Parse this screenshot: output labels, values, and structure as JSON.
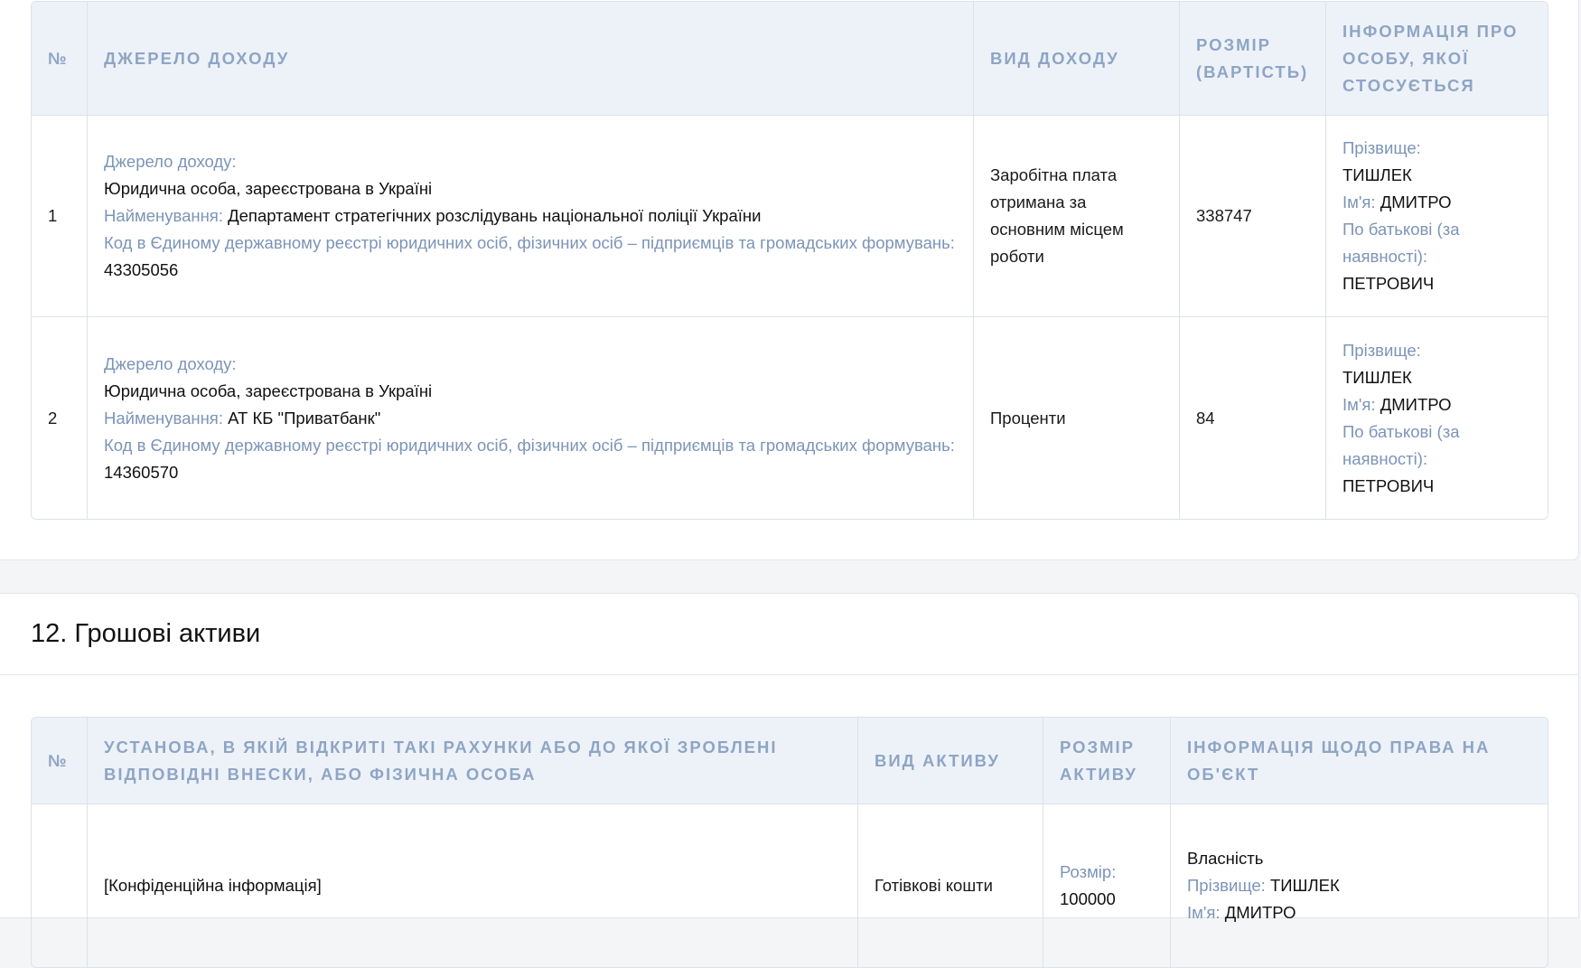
{
  "income_table": {
    "headers": [
      "№",
      "Джерело доходу",
      "Вид доходу",
      "Розмір (вартість)",
      "Інформація про особу, якої стосується"
    ],
    "rows": [
      {
        "num": "1",
        "source_label": "Джерело доходу:",
        "source_value": "Юридична особа, зареєстрована в Україні",
        "name_label": "Найменування:",
        "name_value": "Департамент стратегічних розслідувань національної поліції України",
        "code_label": "Код в Єдиному державному реєстрі юридичних осіб, фізичних осіб – підприємців та громадських формувань:",
        "code_value": "43305056",
        "income_type": "Заробітна плата отримана за основним місцем роботи",
        "amount": "338747",
        "surname_label": "Прізвище:",
        "surname": "ТИШЛЕК",
        "firstname_label": "Ім'я:",
        "firstname": "ДМИТРО",
        "patronymic_label": "По батькові (за наявності):",
        "patronymic": "ПЕТРОВИЧ"
      },
      {
        "num": "2",
        "source_label": "Джерело доходу:",
        "source_value": "Юридична особа, зареєстрована в Україні",
        "name_label": "Найменування:",
        "name_value": "АТ КБ \"Приватбанк\"",
        "code_label": "Код в Єдиному державному реєстрі юридичних осіб, фізичних осіб – підприємців та громадських формувань:",
        "code_value": "14360570",
        "income_type": "Проценти",
        "amount": "84",
        "surname_label": "Прізвище:",
        "surname": "ТИШЛЕК",
        "firstname_label": "Ім'я:",
        "firstname": "ДМИТРО",
        "patronymic_label": "По батькові (за наявності):",
        "patronymic": "ПЕТРОВИЧ"
      }
    ]
  },
  "section12": {
    "title": "12. Грошові активи"
  },
  "assets_table": {
    "headers": [
      "№",
      "Установа, в якій відкриті такі рахунки або до якої зроблені відповідні внески, або фізична особа",
      "Вид активу",
      "Розмір активу",
      "Інформація щодо права на об'єкт"
    ],
    "rows": [
      {
        "institution": "[Конфіденційна інформація]",
        "asset_type": "Готівкові кошти",
        "size_label": "Розмір:",
        "size_value": "100000",
        "ownership": "Власність",
        "surname_label": "Прізвище:",
        "surname": "ТИШЛЕК",
        "firstname_label": "Ім'я:",
        "firstname": "ДМИТРО"
      }
    ]
  },
  "colors": {
    "header_bg": "#edf2f9",
    "header_text": "#8fa5c4",
    "label_text": "#7c94b8",
    "border": "#dde2e8"
  }
}
